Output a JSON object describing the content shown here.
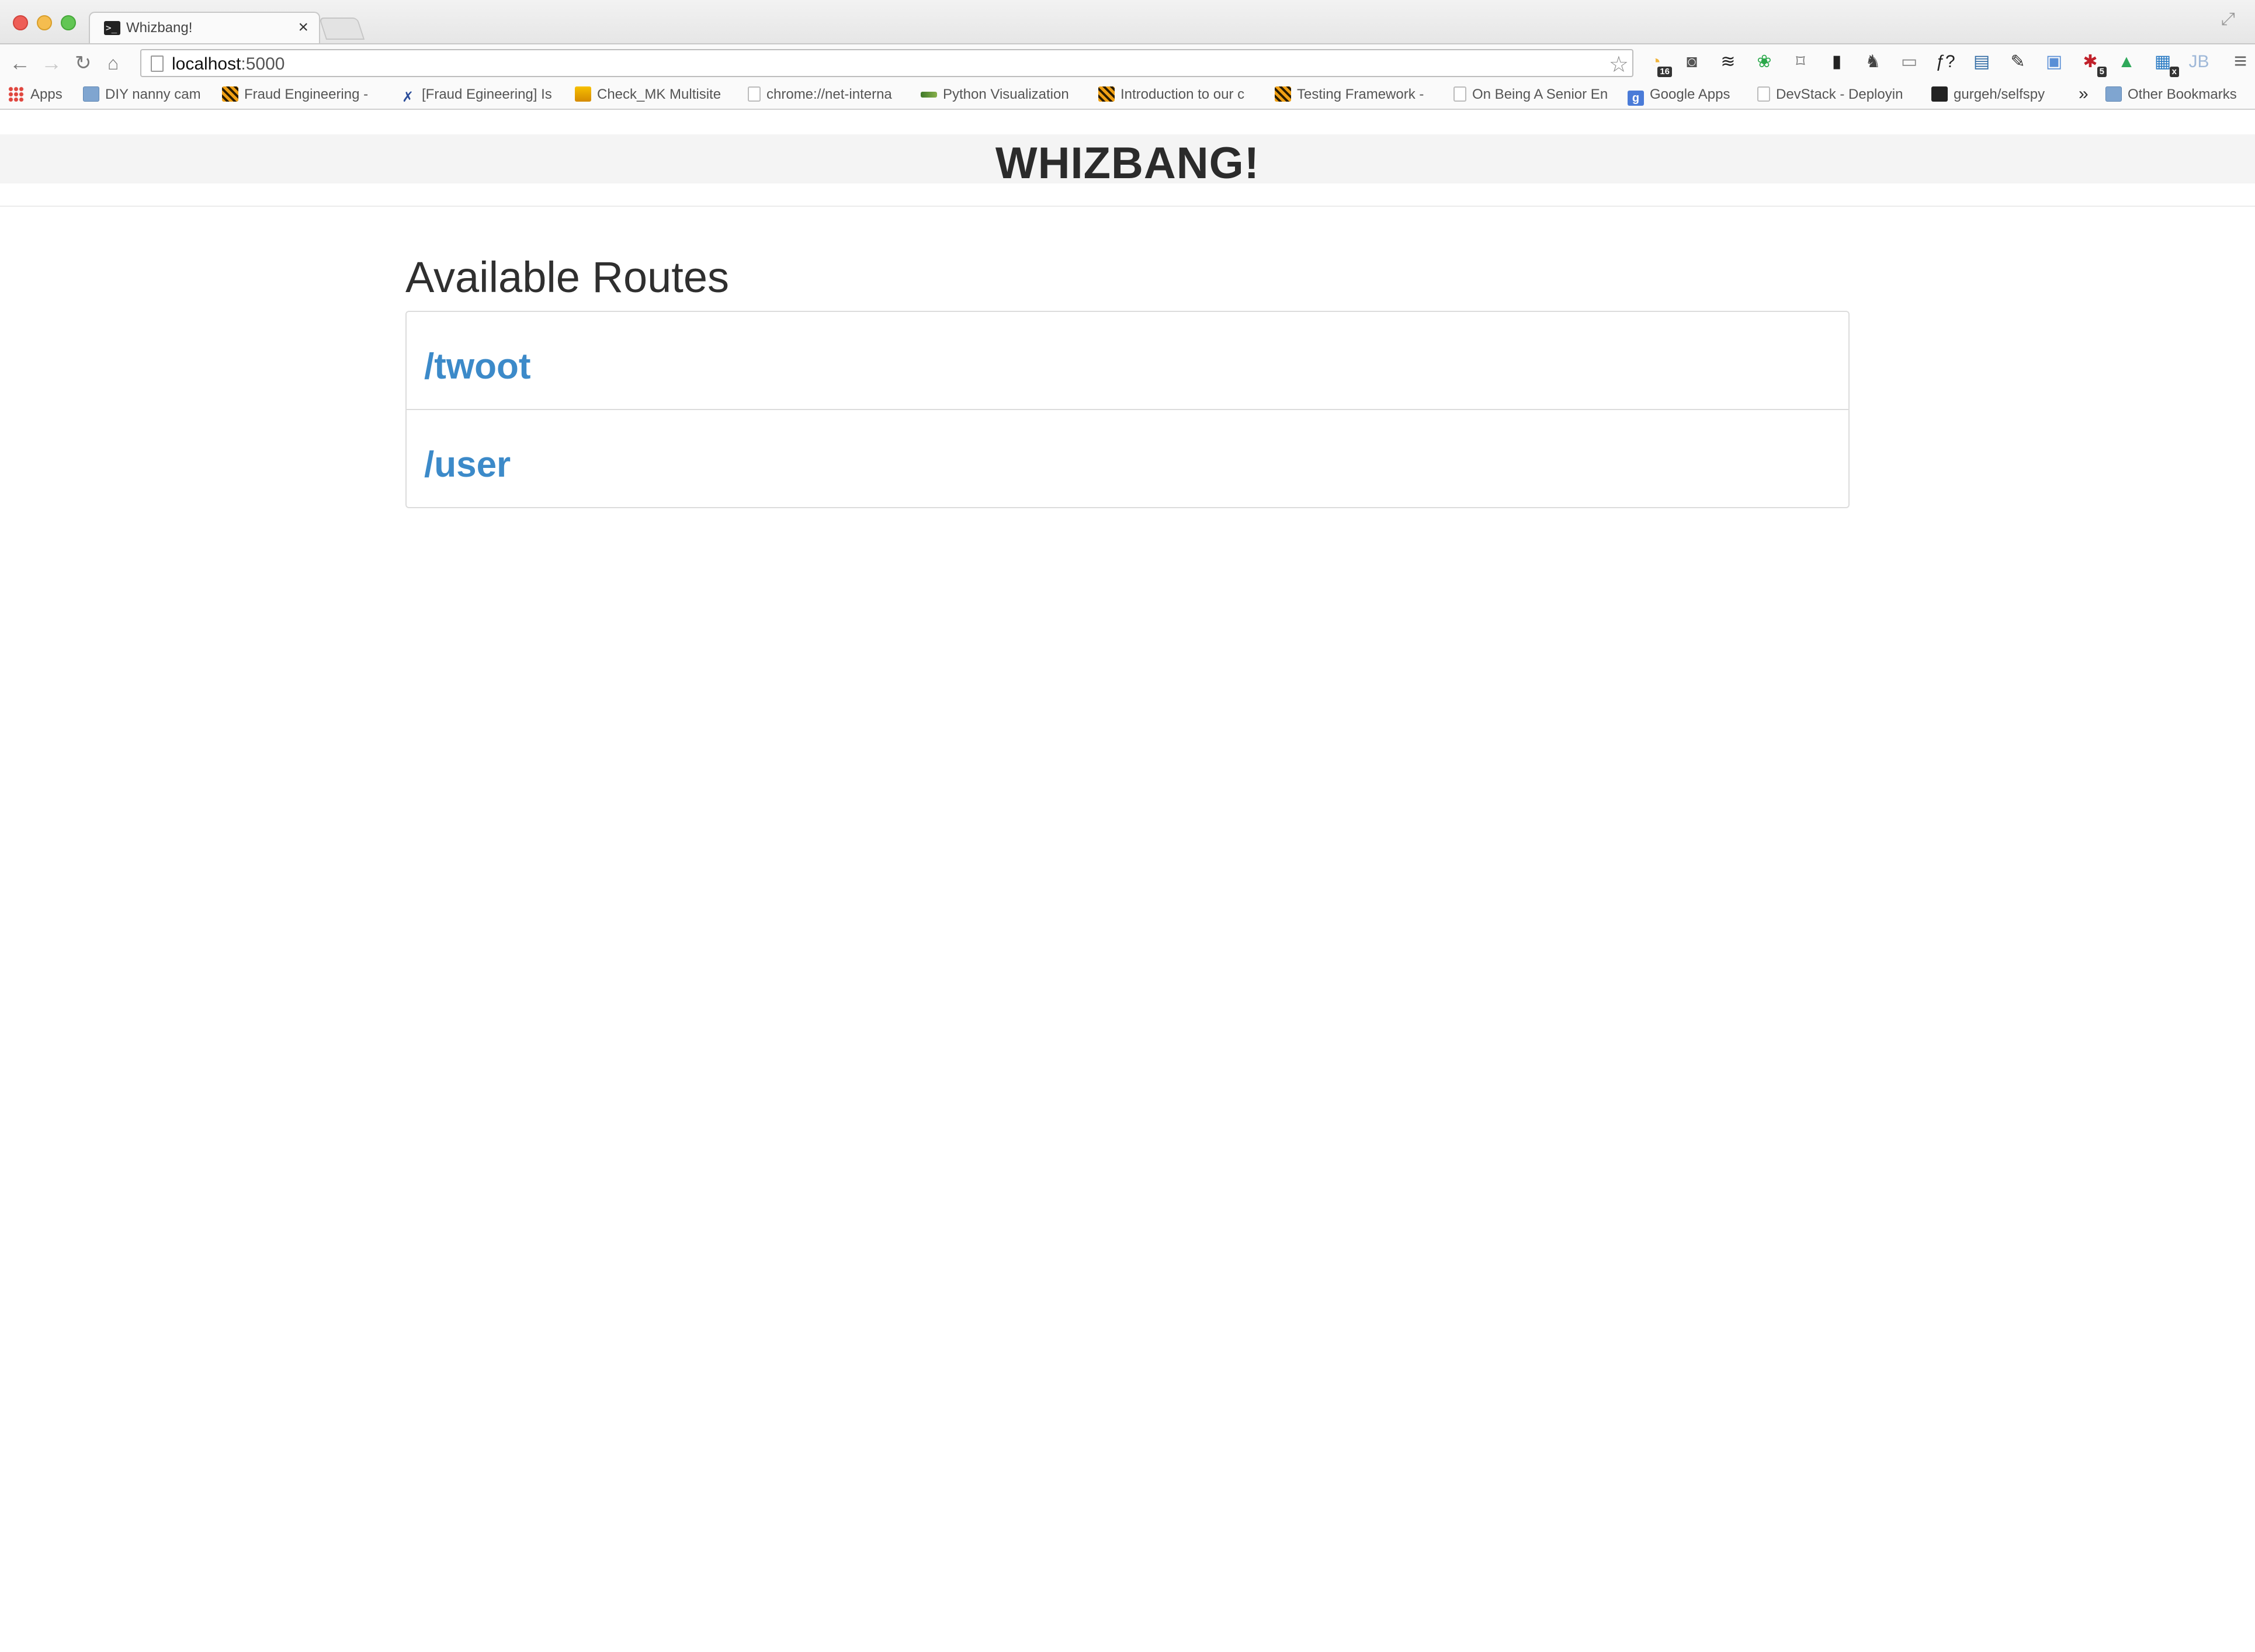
{
  "browser": {
    "tab": {
      "title": "Whizbang!"
    },
    "address": {
      "host": "localhost",
      "port": ":5000"
    },
    "extensions": [
      {
        "name": "clock-extension-icon",
        "glyph": "◔",
        "color": "#f0b43c",
        "badge": "16"
      },
      {
        "name": "pocket-icon",
        "glyph": "◙",
        "color": "#555555",
        "badge": ""
      },
      {
        "name": "buffer-icon",
        "glyph": "≋",
        "color": "#222222",
        "badge": ""
      },
      {
        "name": "evernote-clipper-icon",
        "glyph": "❀",
        "color": "#2aa84a",
        "badge": ""
      },
      {
        "name": "cast-icon",
        "glyph": "⌑",
        "color": "#777777",
        "badge": ""
      },
      {
        "name": "phone-bolt-icon",
        "glyph": "▮",
        "color": "#222222",
        "badge": ""
      },
      {
        "name": "evernote-icon",
        "glyph": "♞",
        "color": "#444444",
        "badge": ""
      },
      {
        "name": "ruler-question-icon",
        "glyph": "▭",
        "color": "#888888",
        "badge": ""
      },
      {
        "name": "font-question-icon",
        "glyph": "ƒ?",
        "color": "#222222",
        "badge": ""
      },
      {
        "name": "chart-extension-icon",
        "glyph": "▤",
        "color": "#2f6aa3",
        "badge": ""
      },
      {
        "name": "pencil-icon",
        "glyph": "✎",
        "color": "#333333",
        "badge": ""
      },
      {
        "name": "window-resizer-icon",
        "glyph": "▣",
        "color": "#5a8fd6",
        "badge": ""
      },
      {
        "name": "lastpass-icon",
        "glyph": "✱",
        "color": "#c0202a",
        "badge": "5"
      },
      {
        "name": "google-drive-icon",
        "glyph": "▲",
        "color": "#2fa85a",
        "badge": ""
      },
      {
        "name": "screen-capture-icon",
        "glyph": "▦",
        "color": "#2a7bc4",
        "badge": "x"
      },
      {
        "name": "jetbrains-icon",
        "glyph": "JB",
        "color": "#9fb8d8",
        "badge": ""
      }
    ],
    "bookmarks": [
      {
        "name": "bookmark-apps",
        "icon": "ico-apps",
        "label": "Apps"
      },
      {
        "name": "bookmark-diy-nanny-cam",
        "icon": "ico-folder",
        "label": "DIY nanny cam"
      },
      {
        "name": "bookmark-fraud-engineering",
        "icon": "ico-tiger",
        "label": "Fraud Engineering -"
      },
      {
        "name": "bookmark-fraud-egineering",
        "icon": "ico-tool",
        "label": "[Fraud Egineering] Is"
      },
      {
        "name": "bookmark-check-mk-multisite",
        "icon": "ico-check",
        "label": "Check_MK Multisite"
      },
      {
        "name": "bookmark-chrome-net-internals",
        "icon": "ico-page",
        "label": "chrome://net-interna"
      },
      {
        "name": "bookmark-python-visualization",
        "icon": "ico-python",
        "label": "Python Visualization"
      },
      {
        "name": "bookmark-introduction",
        "icon": "ico-tiger",
        "label": "Introduction to our c"
      },
      {
        "name": "bookmark-testing-framework",
        "icon": "ico-tiger",
        "label": "Testing Framework -"
      },
      {
        "name": "bookmark-senior-engineer",
        "icon": "ico-page",
        "label": "On Being A Senior En"
      },
      {
        "name": "bookmark-google-apps",
        "icon": "ico-google",
        "label": "Google Apps"
      },
      {
        "name": "bookmark-devstack",
        "icon": "ico-page",
        "label": "DevStack - Deployin"
      },
      {
        "name": "bookmark-selfspy",
        "icon": "ico-github",
        "label": "gurgeh/selfspy"
      }
    ],
    "more_bookmarks": "»",
    "other_bookmarks": "Other Bookmarks"
  },
  "site": {
    "title": "WHIZBANG!",
    "routes_heading": "Available Routes",
    "routes": [
      {
        "path": "/twoot"
      },
      {
        "path": "/user"
      }
    ]
  },
  "colors": {
    "link": "#3c8ac9",
    "header_bg": "#f4f4f4",
    "text": "#2f2f2f"
  }
}
